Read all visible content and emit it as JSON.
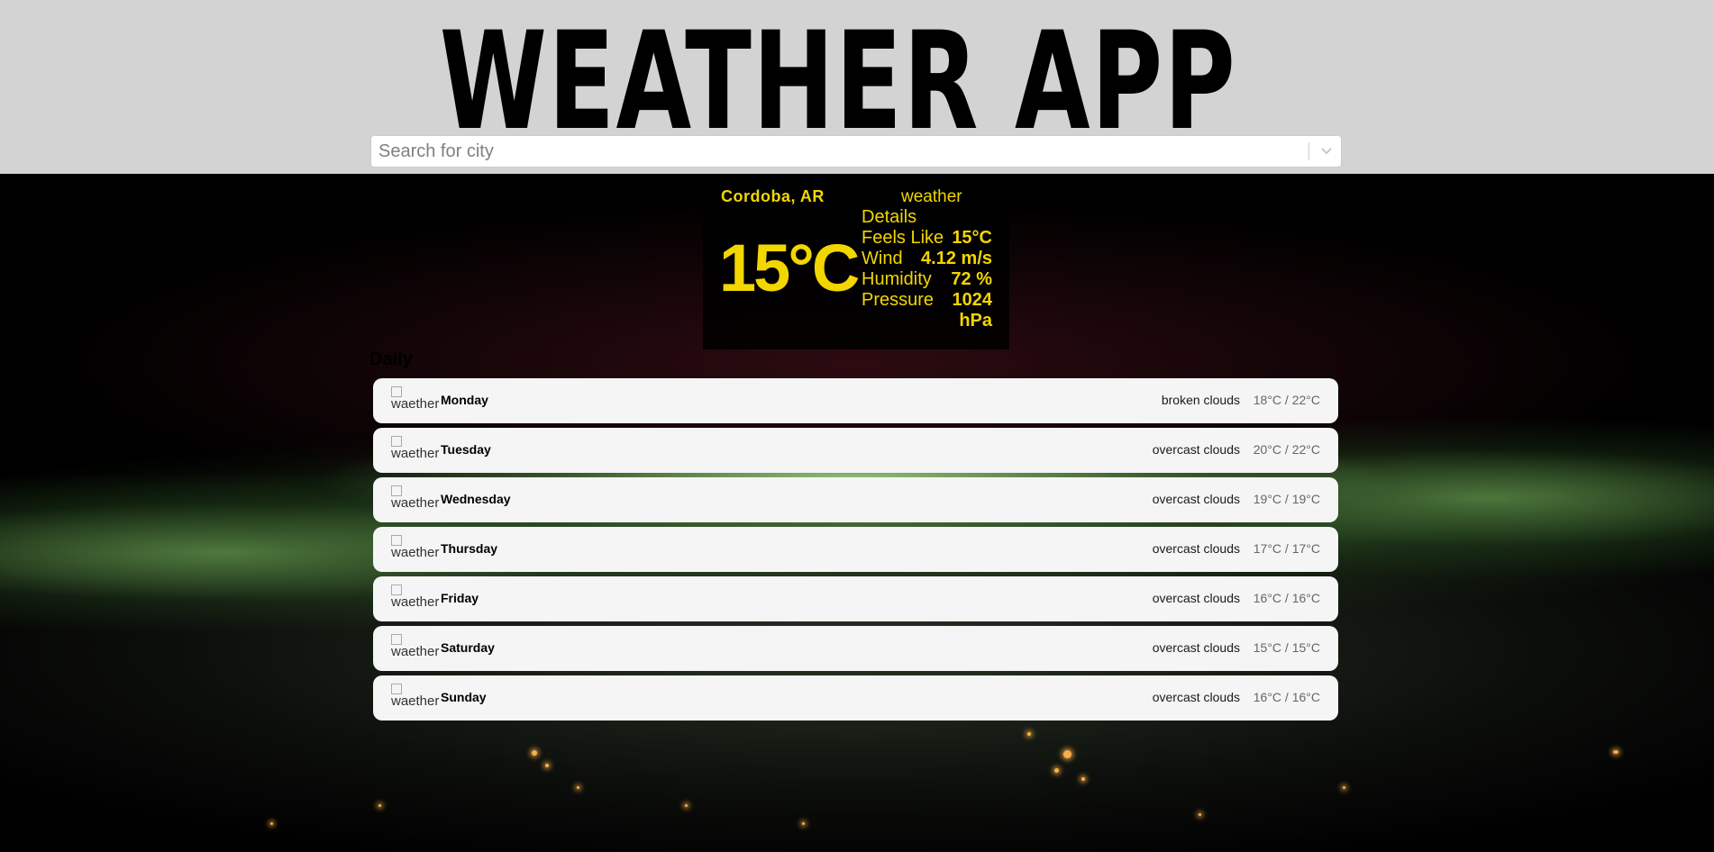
{
  "header": {
    "title": "WEATHER APP",
    "search_placeholder": "Search for city",
    "dropdown_icon": "chevron-down-icon"
  },
  "current": {
    "city": "Cordoba, AR",
    "temperature": "15°C",
    "icon_alt": "weather",
    "details_title": "Details",
    "details": [
      {
        "label": "Feels Like",
        "value": "15°C"
      },
      {
        "label": "Wind",
        "value": "4.12 m/s"
      },
      {
        "label": "Humidity",
        "value": "72 %"
      },
      {
        "label": "Pressure",
        "value": "1024 hPa"
      }
    ],
    "accent_color": "#f2d600"
  },
  "daily": {
    "title": "Daily",
    "icon_alt": "waether",
    "days": [
      {
        "name": "Monday",
        "description": "broken clouds",
        "temps": "18°C / 22°C"
      },
      {
        "name": "Tuesday",
        "description": "overcast clouds",
        "temps": "20°C / 22°C"
      },
      {
        "name": "Wednesday",
        "description": "overcast clouds",
        "temps": "19°C / 19°C"
      },
      {
        "name": "Thursday",
        "description": "overcast clouds",
        "temps": "17°C / 17°C"
      },
      {
        "name": "Friday",
        "description": "overcast clouds",
        "temps": "16°C / 16°C"
      },
      {
        "name": "Saturday",
        "description": "overcast clouds",
        "temps": "15°C / 15°C"
      },
      {
        "name": "Sunday",
        "description": "overcast clouds",
        "temps": "16°C / 16°C"
      }
    ]
  }
}
